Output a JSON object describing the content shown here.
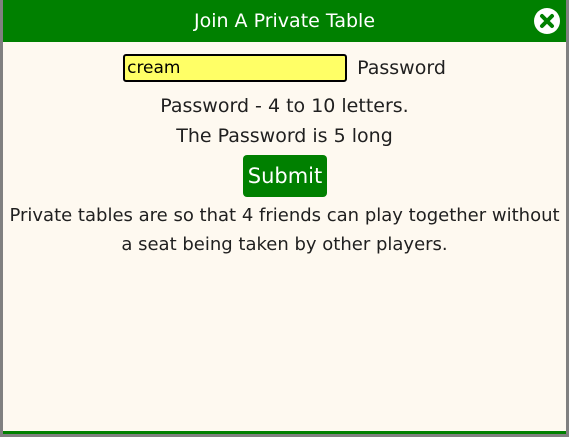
{
  "dialog": {
    "title": "Join A Private Table",
    "close_icon": "close-icon"
  },
  "password": {
    "value": "cream",
    "label": "Password"
  },
  "info": {
    "rule": "Password - 4 to 10 letters.",
    "length": "The Password is 5 long"
  },
  "submit": {
    "label": "Submit"
  },
  "description": "Private tables are so that 4 friends can play together without a seat being taken by other players.",
  "colors": {
    "accent": "#008000",
    "background": "#fef9f0",
    "input_bg": "#ffff66",
    "frame": "#808080"
  }
}
